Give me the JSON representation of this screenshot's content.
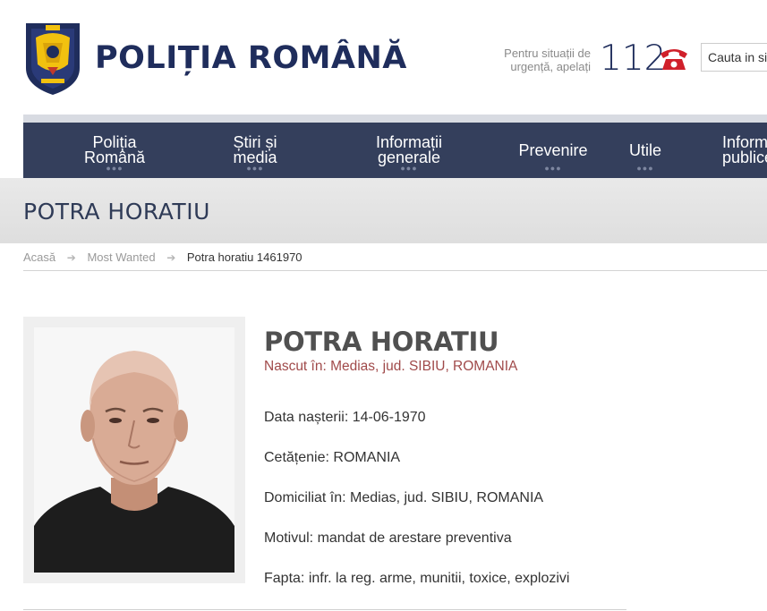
{
  "header": {
    "title": "POLIȚIA ROMÂNĂ",
    "emergency_line1": "Pentru situații de",
    "emergency_line2": "urgență, apelați",
    "emergency_number": "112",
    "search_placeholder": "Cauta in site"
  },
  "nav": {
    "items": [
      {
        "label": "Poliția\nRomână"
      },
      {
        "label": "Știri și\nmedia"
      },
      {
        "label": "Informații\ngenerale"
      },
      {
        "label": "Prevenire"
      },
      {
        "label": "Utile"
      },
      {
        "label": "Informații\npublice"
      }
    ],
    "dots": "●●●"
  },
  "banner": {
    "title": "POTRA HORATIU"
  },
  "breadcrumb": {
    "home": "Acasă",
    "section": "Most Wanted",
    "current": "Potra horatiu 1461970",
    "separator": "➔"
  },
  "profile": {
    "name": "POTRA HORATIU",
    "birthplace": "Nascut în: Medias, jud. SIBIU, ROMANIA",
    "fields": [
      {
        "label": "Data nașterii:",
        "value": "14-06-1970"
      },
      {
        "label": "Cetățenie:",
        "value": "ROMANIA"
      },
      {
        "label": "Domiciliat în:",
        "value": "Medias, jud. SIBIU, ROMANIA"
      },
      {
        "label": "Motivul:",
        "value": "mandat de arestare preventiva"
      },
      {
        "label": "Fapta:",
        "value": "infr. la reg. arme, munitii, toxice, explozivi"
      }
    ]
  },
  "colors": {
    "brand_navy": "#1f2d5c",
    "nav_background": "#343f5c",
    "birthplace_red": "#a04a4a",
    "phone_red": "#d0202a"
  },
  "icons": {
    "logo": "police-crest-icon",
    "phone": "phone-icon",
    "breadcrumb_separator": "arrow-right-icon"
  }
}
